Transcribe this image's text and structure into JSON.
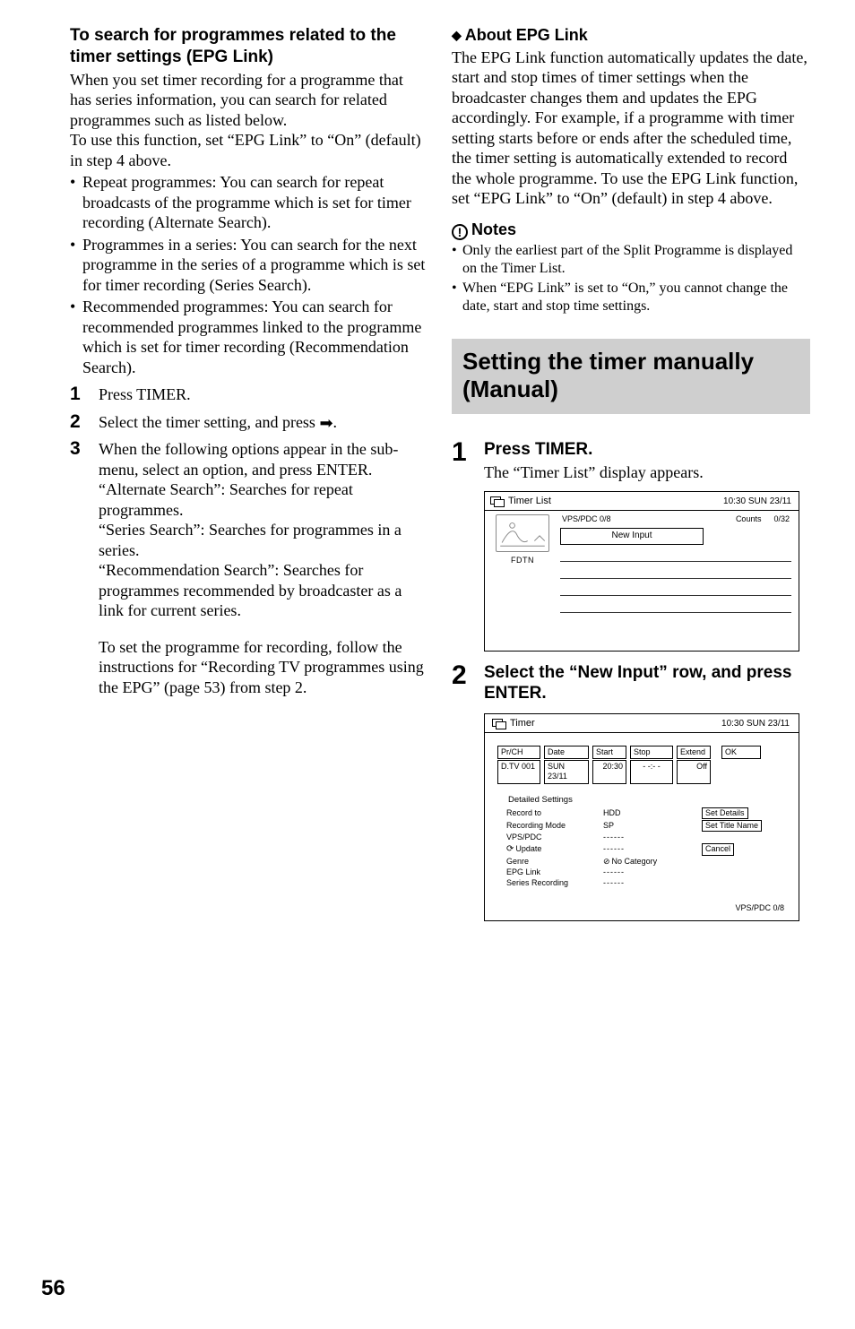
{
  "left": {
    "heading": "To search for programmes related to the timer settings (EPG Link)",
    "intro": "When you set timer recording for a programme that has series information, you can search for related programmes such as listed below.\nTo use this function, set “EPG Link” to “On” (default) in step 4 above.",
    "bullets": [
      "Repeat programmes: You can search for repeat broadcasts of the programme which is set for timer recording (Alternate Search).",
      "Programmes in a series: You can search for the next programme in the series of a programme which is set for timer recording (Series Search).",
      "Recommended programmes: You can search for recommended programmes linked to the programme which is set for timer recording (Recommendation Search)."
    ],
    "steps": {
      "s1": "Press TIMER.",
      "s2_a": "Select the timer setting, and press ",
      "s2_b": ".",
      "s3_a": "When the following options appear in the sub-menu, select an option, and press ENTER.",
      "s3_b": "“Alternate Search”: Searches for repeat programmes.",
      "s3_c": "“Series Search”: Searches for programmes in a series.",
      "s3_d": "“Recommendation Search”: Searches for programmes recommended by broadcaster as a link for current series.",
      "s3_e": "To set the programme for recording, follow the instructions for “Recording TV programmes using the EPG” (page 53) from step 2."
    }
  },
  "right": {
    "about_head": "About EPG Link",
    "about_body": "The EPG Link function automatically updates the date, start and stop times of timer settings when the broadcaster changes them and updates the EPG accordingly. For example, if a programme with timer setting starts before or ends after the scheduled time, the timer setting is automatically extended to record the whole programme. To use the EPG Link function, set “EPG Link” to “On” (default) in step 4 above.",
    "notes_head": "Notes",
    "notes": [
      "Only the earliest part of the Split Programme is displayed on the Timer List.",
      "When “EPG Link” is set to “On,” you cannot change the date, start and stop time settings."
    ],
    "section_box": "Setting the timer manually (Manual)",
    "step1_head": "Press TIMER.",
    "step1_sub": "The “Timer List” display appears.",
    "step2_head": "Select the “New Input” row, and press ENTER."
  },
  "shot1": {
    "title": "Timer List",
    "clock": "10:30 SUN    23/11",
    "vps": "VPS/PDC 0/8",
    "counts": "Counts",
    "counts_n": "0/32",
    "newinput": "New Input",
    "fdtn": "FDTN"
  },
  "shot2": {
    "title": "Timer",
    "clock": "10:30 SUN    23/11",
    "h": {
      "prch": "Pr/CH",
      "date": "Date",
      "start": "Start",
      "stop": "Stop",
      "extend": "Extend",
      "ok": "OK"
    },
    "v": {
      "prch": "D.TV 001",
      "date": "SUN 23/11",
      "start": "20:30",
      "stop": "- -:- -",
      "extend": "Off"
    },
    "detailed": "Detailed Settings",
    "rows": {
      "record_to_l": "Record to",
      "record_to_v": "HDD",
      "recmode_l": "Recording Mode",
      "recmode_v": "SP",
      "vpspdc_l": "VPS/PDC",
      "vpspdc_v": "------",
      "update_l": "Update",
      "update_v": "------",
      "genre_l": "Genre",
      "genre_v": "No Category",
      "epg_l": "EPG Link",
      "epg_v": "------",
      "series_l": "Series Recording",
      "series_v": "------"
    },
    "btns": {
      "details": "Set Details",
      "titlename": "Set Title Name",
      "cancel": "Cancel"
    },
    "foot": "VPS/PDC 0/8"
  },
  "page_number": "56"
}
